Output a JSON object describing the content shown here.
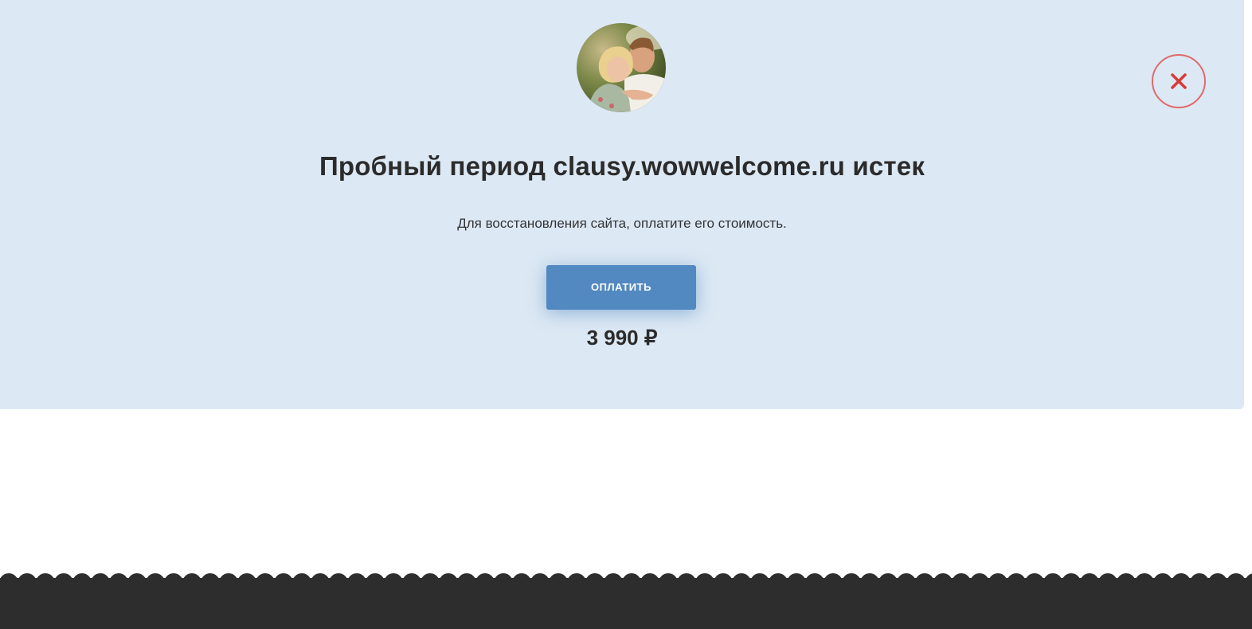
{
  "modal": {
    "title": "Пробный период clausy.wowwelcome.ru истек",
    "subtitle": "Для восстановления сайта, оплатите его стоимость.",
    "pay_button_label": "ОПЛАТИТЬ",
    "price": "3 990 ₽",
    "avatar_icon": "couple-photo-avatar",
    "close_icon": "close-icon"
  },
  "colors": {
    "panel_background": "#dce8f4",
    "button": "#5289c0",
    "close_border": "#e06a6a",
    "close_cross": "#d93a3a",
    "footer": "#2d2d2d",
    "text": "#2b2b2b"
  }
}
